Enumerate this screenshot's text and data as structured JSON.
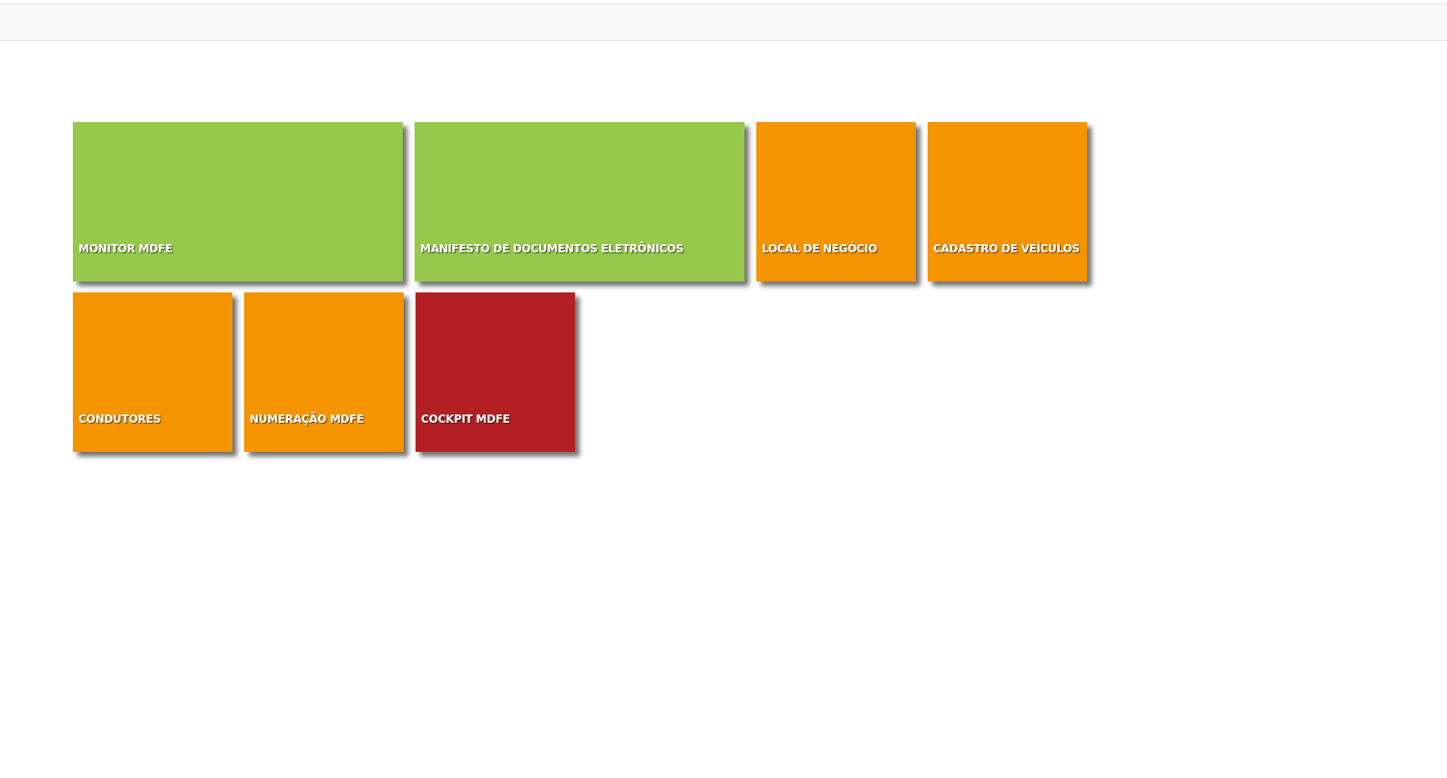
{
  "tile_rows": [
    {
      "tiles": [
        {
          "label": "MONITOR MDFE",
          "kind": "wide",
          "color": "#96c84b"
        },
        {
          "label": "MANIFESTO DE DOCUMENTOS ELETRÔNICOS",
          "kind": "wide",
          "color": "#96c84b"
        },
        {
          "label": "LOCAL DE NEGÓCIO",
          "kind": "square",
          "color": "#f39400"
        },
        {
          "label": "CADASTRO DE VEÍCULOS",
          "kind": "square",
          "color": "#f39400"
        }
      ]
    },
    {
      "tiles": [
        {
          "label": "CONDUTORES",
          "kind": "square",
          "color": "#f39400"
        },
        {
          "label": "NUMERAÇÃO MDFE",
          "kind": "square",
          "color": "#f39400"
        },
        {
          "label": "COCKPIT MDFE",
          "kind": "square",
          "color": "#b22024"
        }
      ]
    }
  ]
}
